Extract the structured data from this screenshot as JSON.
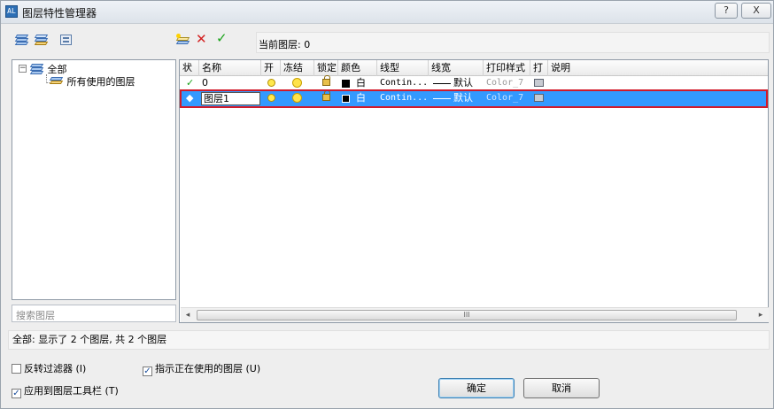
{
  "window": {
    "title": "图层特性管理器",
    "help_label": "?",
    "close_label": "X",
    "app_icon_label": "AL"
  },
  "toolbar": {
    "left_icons": [
      "new-property-filter-icon",
      "new-group-filter-icon",
      "layer-states-manager-icon"
    ],
    "right_icons": [
      "new-layer-icon",
      "delete-layer-icon",
      "set-current-icon"
    ],
    "delete_symbol": "✕",
    "current_symbol": "✓",
    "current_layer_label": "当前图层: 0"
  },
  "tree": {
    "toggle": "−",
    "root": "全部",
    "child": "所有使用的图层"
  },
  "search": {
    "placeholder": "搜索图层"
  },
  "grid": {
    "headers": [
      "状",
      "名称",
      "开",
      "冻结",
      "锁定",
      "颜色",
      "线型",
      "线宽",
      "打印样式",
      "打",
      "说明"
    ],
    "rows": [
      {
        "status": "✓",
        "name": "0",
        "color": "白",
        "linetype": "Contin...",
        "lineweight": "默认",
        "plotstyle": "Color_7",
        "selected": false
      },
      {
        "status": "◆",
        "name": "图层1",
        "color": "白",
        "linetype": "Contin...",
        "lineweight": "默认",
        "plotstyle": "Color_7",
        "selected": true
      }
    ],
    "scroll": {
      "left": "◂",
      "right": "▸",
      "grip": "III"
    }
  },
  "status": {
    "text": "全部: 显示了 2 个图层, 共 2 个图层"
  },
  "options": {
    "invert_filter": {
      "label": "反转过滤器 (I)",
      "checked": false
    },
    "indicate_in_use": {
      "label": "指示正在使用的图层 (U)",
      "checked": true
    },
    "apply_to_toolbar": {
      "label": "应用到图层工具栏 (T)",
      "checked": true
    },
    "check_mark": "✓"
  },
  "buttons": {
    "ok": "确定",
    "cancel": "取消"
  },
  "colors": {
    "selection": "#3399ff",
    "highlight_border": "#d11a2a",
    "current_check": "#1aa31a",
    "delete_x": "#d32020"
  }
}
